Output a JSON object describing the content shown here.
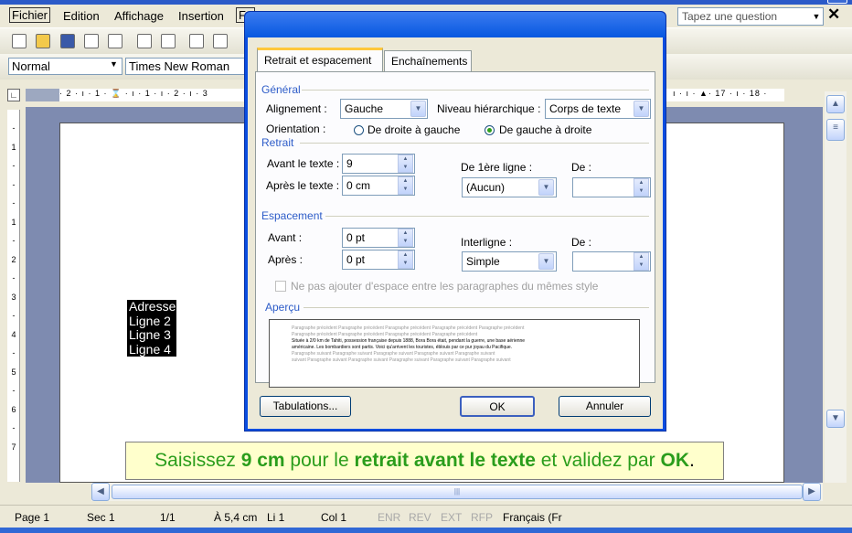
{
  "menubar": {
    "items": [
      "Fichier",
      "Edition",
      "Affichage",
      "Insertion",
      "Fo"
    ],
    "ask_placeholder": "Tapez une question",
    "close_glyph": "✕"
  },
  "formatting": {
    "style": "Normal",
    "font": "Times New Roman"
  },
  "ruler": {
    "left_marks": "· 2 · ı · 1 · ⌛ · ı · 1 · ı · 2 · ı · 3",
    "right_marks": "ı · ı · ▲· 17 · ı · 18 ·",
    "vertical_marks": [
      "-",
      "1",
      "-",
      "-",
      "-",
      "1",
      "-",
      "2",
      "-",
      "3",
      "-",
      "4",
      "-",
      "5",
      "-",
      "6",
      "-",
      "7"
    ]
  },
  "document": {
    "address_lines": [
      "Adresse",
      "Ligne 2",
      "Ligne 3",
      "Ligne 4"
    ],
    "hint_parts": [
      "Saisissez ",
      "9 cm",
      " pour le ",
      "retrait avant le texte",
      " et validez par ",
      "OK",
      "."
    ]
  },
  "dialog": {
    "tabs": [
      "Retrait et espacement",
      "Enchaînements"
    ],
    "general": {
      "title": "Général",
      "alignment_label": "Alignement :",
      "alignment_value": "Gauche",
      "outline_label": "Niveau hiérarchique :",
      "outline_value": "Corps de texte",
      "orientation_label": "Orientation :",
      "rtl_label": "De droite à gauche",
      "ltr_label": "De gauche à droite"
    },
    "indent": {
      "title": "Retrait",
      "before_label": "Avant le texte :",
      "before_value": "9",
      "after_label": "Après le texte :",
      "after_value": "0 cm",
      "first_label": "De 1ère ligne :",
      "first_value": "(Aucun)",
      "by_label": "De :",
      "by_value": ""
    },
    "spacing": {
      "title": "Espacement",
      "before_label": "Avant :",
      "before_value": "0 pt",
      "after_label": "Après :",
      "after_value": "0 pt",
      "line_label": "Interligne :",
      "line_value": "Simple",
      "at_label": "De :",
      "at_value": "",
      "no_space_label": "Ne pas ajouter d'espace entre les paragraphes du mêmes style"
    },
    "preview": {
      "title": "Aperçu",
      "prev": "Paragraphe précédent   Paragraphe précédent   Paragraphe précédent   Paragraphe précédent   Paragraphe précédent",
      "prev2": "Paragraphe précédent   Paragraphe précédent   Paragraphe précédent   Paragraphe précédent",
      "sample1": "Située à 2/0 km de Tahiti, possession française depuis 1888, Bora Bora était, pendant la guerre, une base aérienne",
      "sample2": "américaine. Les bombardiers sont partis. Voici qu'arrivent les touristes, éblouis par ce pur joyau du Pacifique.",
      "next": "Paragraphe suivant   Paragraphe suivant   Paragraphe suivant   Paragraphe suivant   Paragraphe suivant",
      "next2": "suivant  Paragraphe suivant   Paragraphe suivant   Paragraphe suivant   Paragraphe suivant   Paragraphe suivant"
    },
    "buttons": {
      "tabs": "Tabulations...",
      "ok": "OK",
      "cancel": "Annuler"
    }
  },
  "statusbar": {
    "page": "Page 1",
    "sec": "Sec 1",
    "pages": "1/1",
    "at": "À 5,4 cm",
    "line": "Li 1",
    "col": "Col 1",
    "enr": "ENR",
    "rev": "REV",
    "ext": "EXT",
    "rfp": "RFP",
    "lang": "Français (Fr"
  },
  "scroll": {
    "thumb_grip": "|||"
  }
}
